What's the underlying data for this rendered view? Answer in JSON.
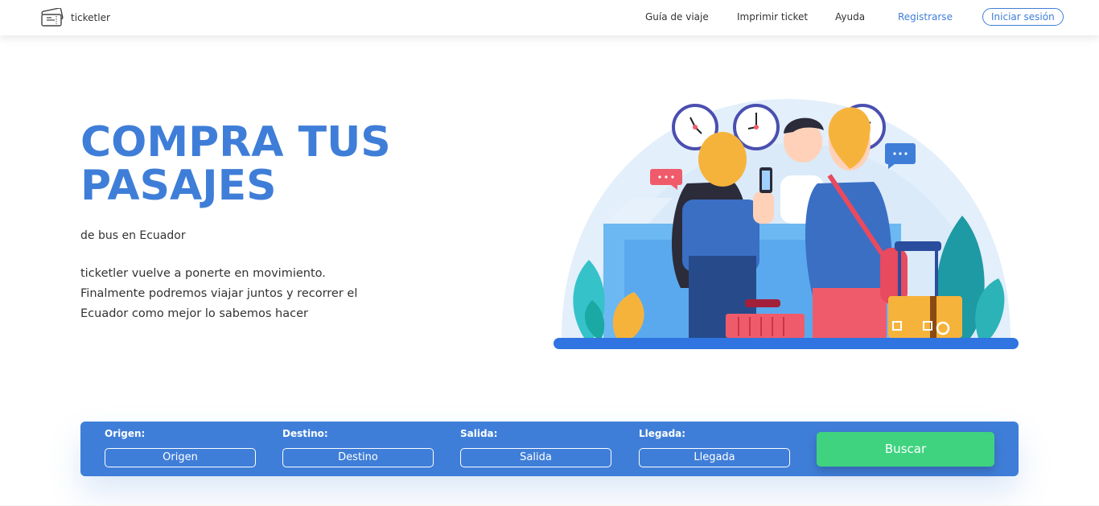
{
  "brand": {
    "name": "ticketler"
  },
  "nav": {
    "items": [
      {
        "label": "Guía de viaje"
      },
      {
        "label": "Imprimir ticket"
      },
      {
        "label": "Ayuda"
      }
    ],
    "register_label": "Registrarse",
    "login_label": "Iniciar sesión"
  },
  "hero": {
    "title_line1": "COMPRA TUS",
    "title_line2": "PASAJES",
    "subtitle": "de bus en Ecuador",
    "description": "ticketler vuelve a ponerte en movimiento. Finalmente podremos viajar juntos y recorrer el Ecuador como mejor lo sabemos hacer"
  },
  "search": {
    "fields": [
      {
        "label": "Origen:",
        "value": "Origen"
      },
      {
        "label": "Destino:",
        "value": "Destino"
      },
      {
        "label": "Salida:",
        "value": "Salida"
      },
      {
        "label": "Llegada:",
        "value": "Llegada"
      }
    ],
    "button_label": "Buscar"
  },
  "colors": {
    "primary": "#3f7ed8",
    "button_green": "#3fd37f",
    "text": "#333333"
  }
}
